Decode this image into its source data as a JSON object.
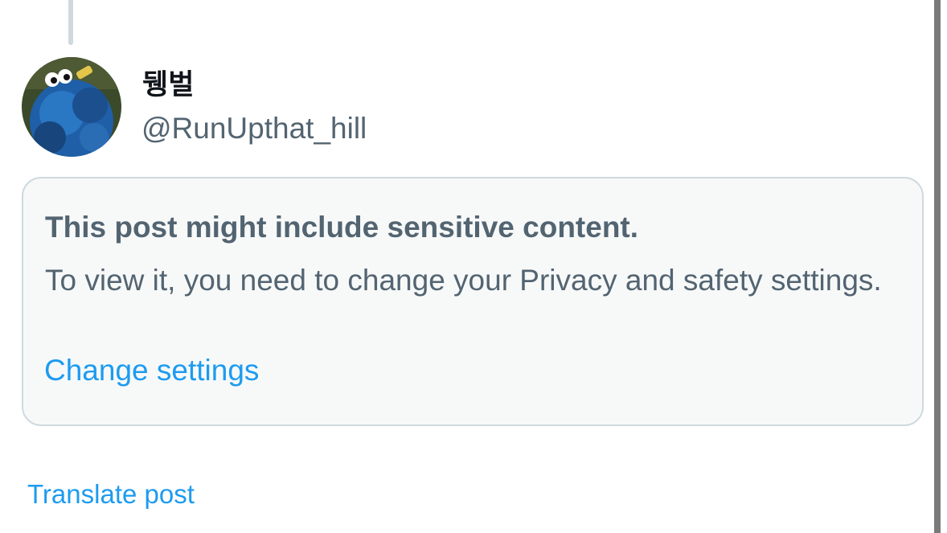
{
  "thread": {
    "connector": "thread-line"
  },
  "author": {
    "display_name": "뒝벌",
    "handle": "@RunUpthat_hill",
    "avatar_icon": "cookie-monster-avatar"
  },
  "sensitive_notice": {
    "title": "This post might include sensitive content.",
    "body": "To view it, you need to change your Privacy and safety settings.",
    "action_label": "Change settings"
  },
  "footer": {
    "translate_label": "Translate post"
  },
  "colors": {
    "primary_text": "#0f1419",
    "secondary_text": "#536471",
    "link": "#1d9bf0",
    "card_background": "#f7f9f9",
    "card_border": "#cfd9de"
  }
}
